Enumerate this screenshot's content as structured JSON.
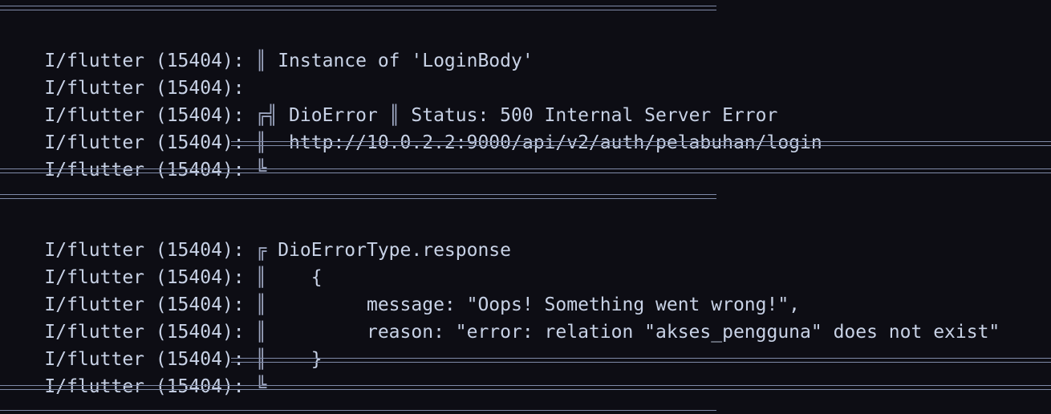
{
  "log": {
    "prefix": "I/flutter (15404): ",
    "block1": {
      "instance_text": " Instance of 'LoginBody'",
      "error_title": " DioError ",
      "status_text": " Status: 500 Internal Server Error",
      "url": "  http://10.0.2.2:9000/api/v2/auth/pelabuhan/login"
    },
    "block2": {
      "type_text": " DioErrorType.response",
      "open_brace": "    {",
      "message_line": "         message: \"Oops! Something went wrong!\",",
      "reason_line": "         reason: \"error: relation \"akses_pengguna\" does not exist\"",
      "close_brace": "    }"
    }
  },
  "colors": {
    "background": "#0d0d14",
    "text": "#c8d2e6",
    "rule": "#7f8aa8"
  }
}
